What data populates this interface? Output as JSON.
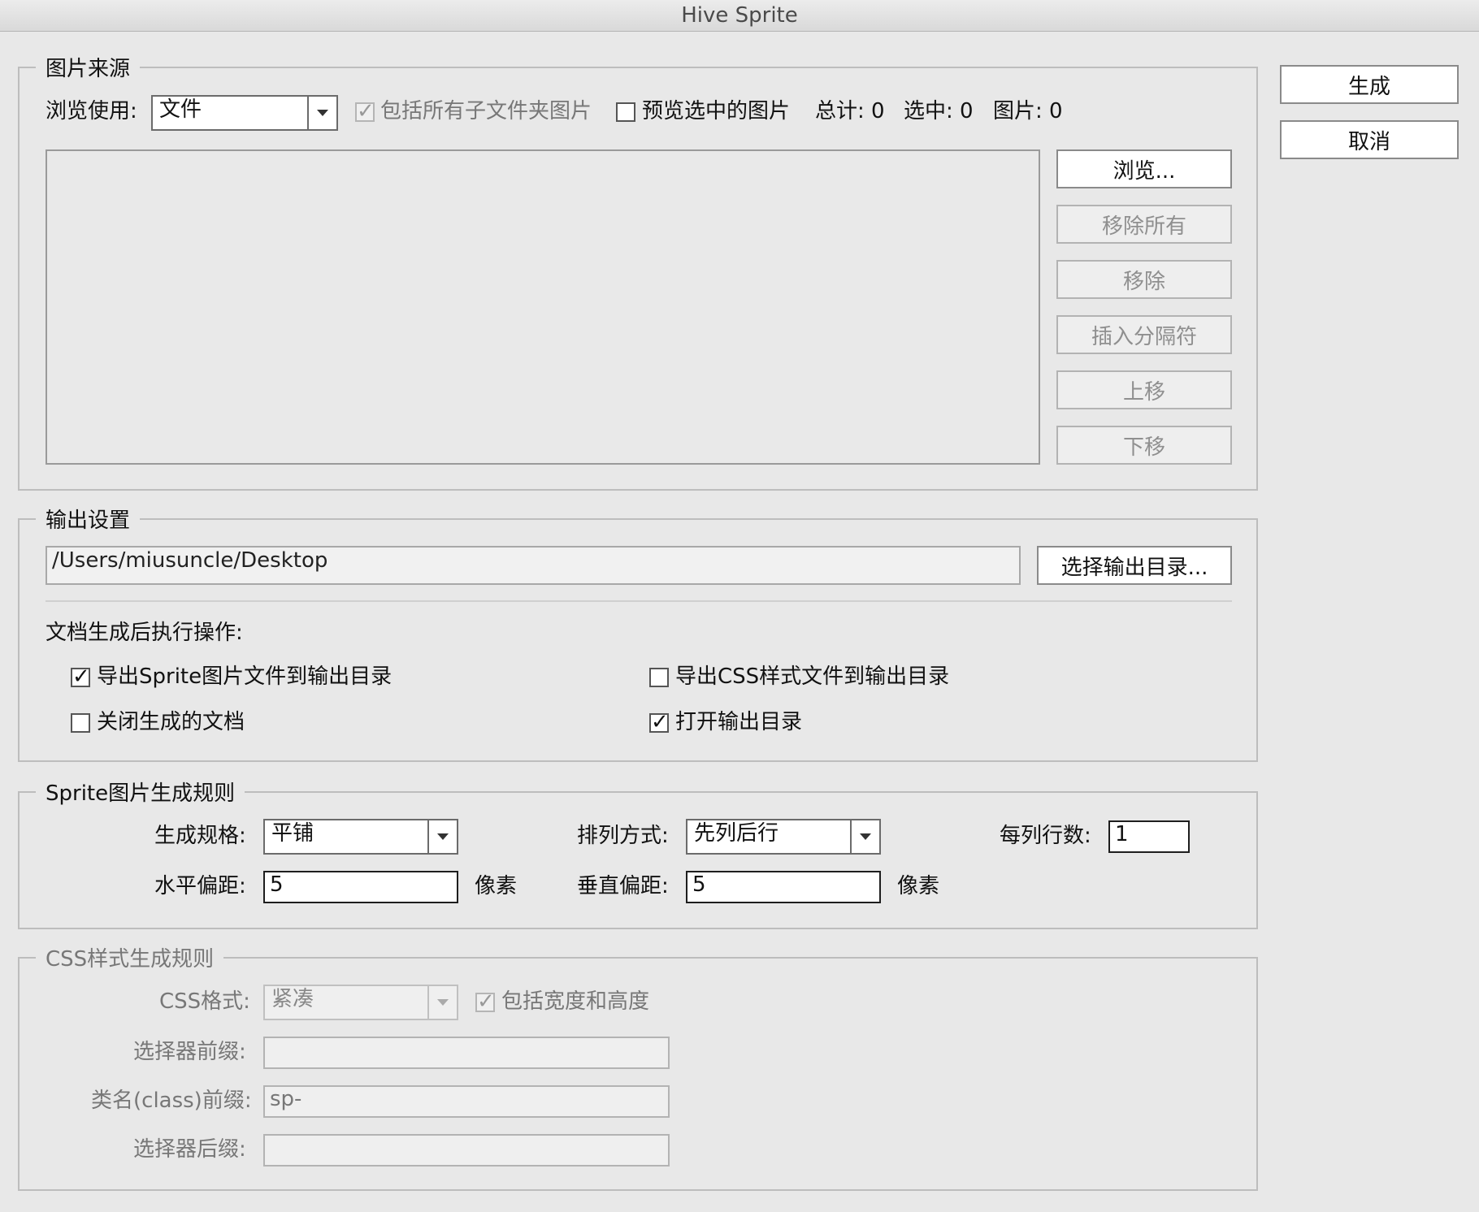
{
  "window": {
    "title": "Hive Sprite"
  },
  "actions": {
    "generate": "生成",
    "cancel": "取消"
  },
  "source": {
    "legend": "图片来源",
    "browse_label": "浏览使用:",
    "browse_value": "文件",
    "include_subfolders": {
      "label": "包括所有子文件夹图片",
      "checked": true
    },
    "preview_selected": {
      "label": "预览选中的图片",
      "checked": false
    },
    "total": "总计: 0",
    "selected": "选中: 0",
    "images": "图片: 0",
    "buttons": {
      "browse": "浏览...",
      "remove_all": "移除所有",
      "remove": "移除",
      "insert_separator": "插入分隔符",
      "move_up": "上移",
      "move_down": "下移"
    }
  },
  "output": {
    "legend": "输出设置",
    "path": "/Users/miusuncle/Desktop",
    "choose_dir": "选择输出目录...",
    "after_label": "文档生成后执行操作:",
    "export_sprite": {
      "label": "导出Sprite图片文件到输出目录",
      "checked": true
    },
    "export_css": {
      "label": "导出CSS样式文件到输出目录",
      "checked": false
    },
    "close_doc": {
      "label": "关闭生成的文档",
      "checked": false
    },
    "open_dir": {
      "label": "打开输出目录",
      "checked": true
    }
  },
  "sprite": {
    "legend": "Sprite图片生成规则",
    "spec_label": "生成规格:",
    "spec_value": "平铺",
    "arrange_label": "排列方式:",
    "arrange_value": "先列后行",
    "rows_label": "每列行数:",
    "rows_value": "1",
    "h_gap_label": "水平偏距:",
    "h_gap_value": "5",
    "v_gap_label": "垂直偏距:",
    "v_gap_value": "5",
    "unit": "像素"
  },
  "css": {
    "legend": "CSS样式生成规则",
    "format_label": "CSS格式:",
    "format_value": "紧凑",
    "include_size": {
      "label": "包括宽度和高度",
      "checked": true
    },
    "selector_prefix_label": "选择器前缀:",
    "selector_prefix_value": "",
    "class_prefix_label": "类名(class)前缀:",
    "class_prefix_value": "sp-",
    "selector_suffix_label": "选择器后缀:",
    "selector_suffix_value": ""
  }
}
